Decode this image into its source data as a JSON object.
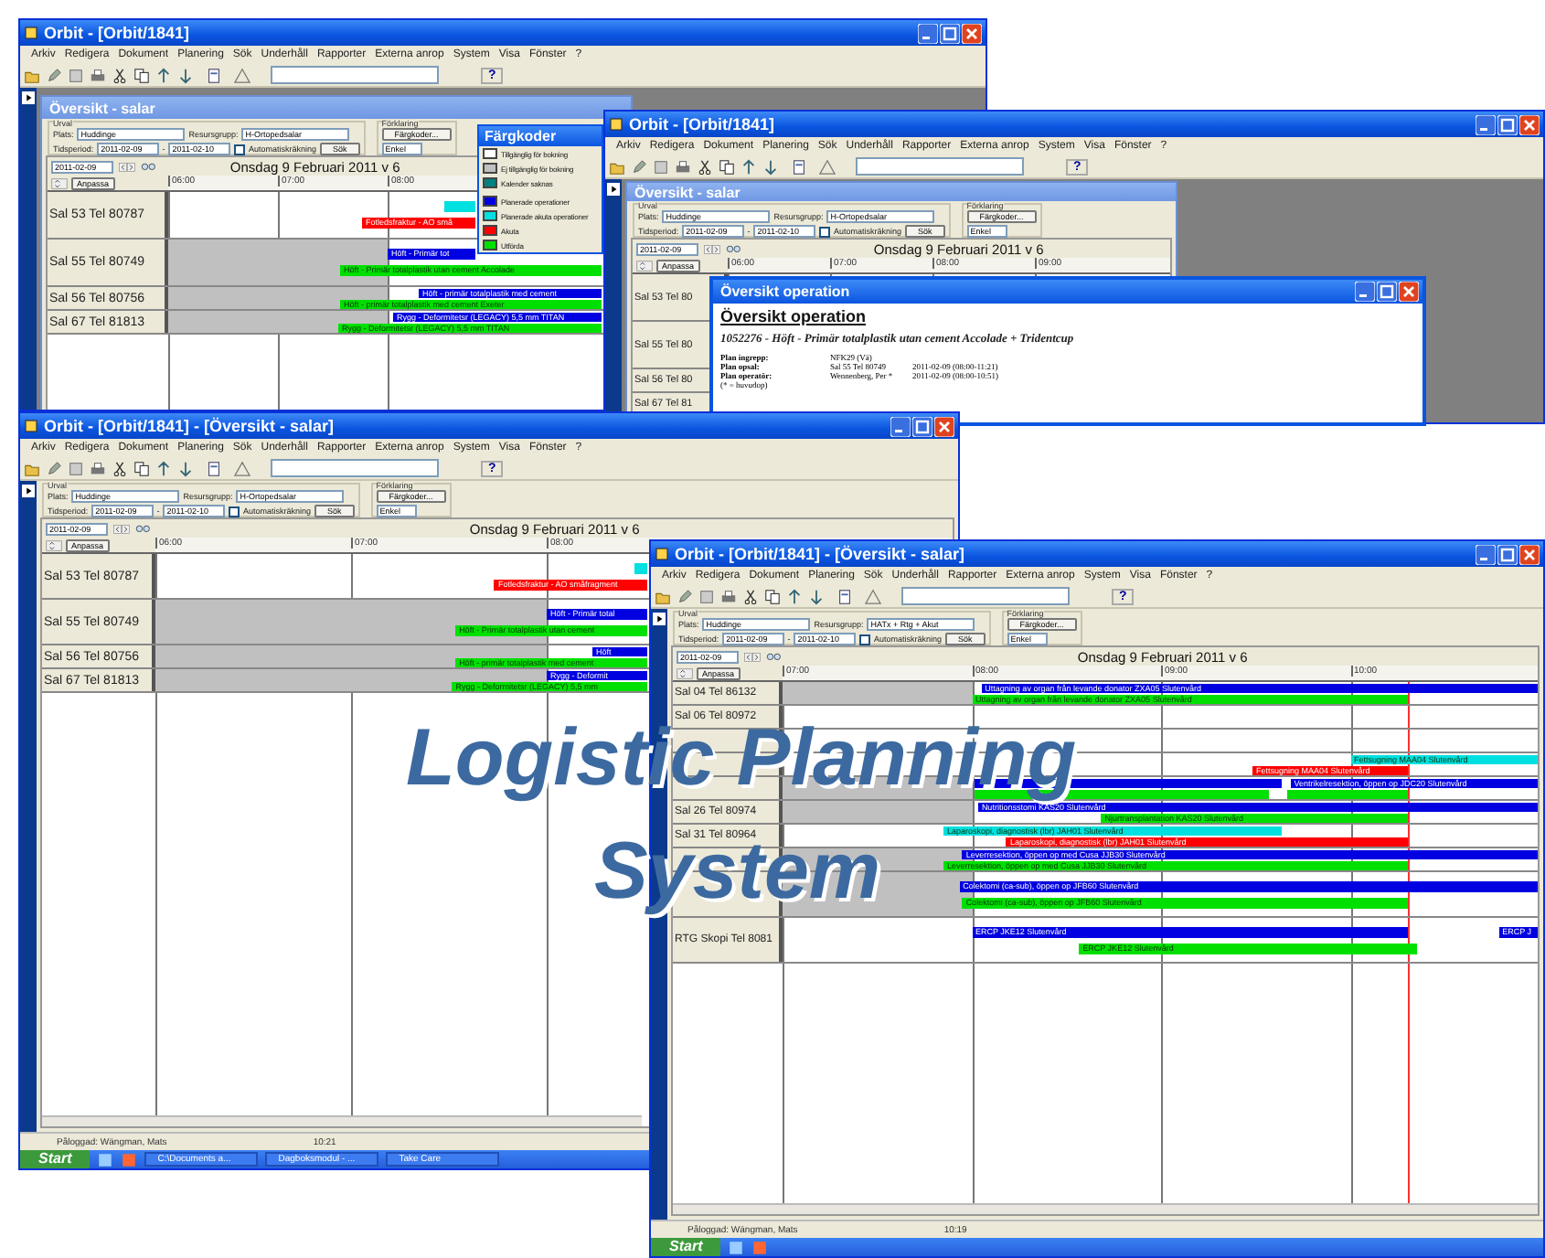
{
  "windows": [
    {
      "title": "Orbit - [Orbit/1841]",
      "menu": [
        "Arkiv",
        "Redigera",
        "Dokument",
        "Planering",
        "Sök",
        "Underhåll",
        "Rapporter",
        "Externa anrop",
        "System",
        "Visa",
        "Fönster",
        "?"
      ],
      "help": "?",
      "child": {
        "title": "Översikt - salar",
        "form": {
          "group": "Urval",
          "plats_label": "Plats:",
          "plats": "Huddinge",
          "resurs_label": "Resursgrupp:",
          "resurs": "H-Ortopedsalar",
          "period_label": "Tidsperiod:",
          "from": "2011-02-09",
          "dash": "-",
          "to": "2011-02-10",
          "auto_label": "Automatiskräkning",
          "auto_checked": false,
          "search": "Sök",
          "legend_group": "Förklaring",
          "legend_button": "Färgkoder...",
          "view": "Enkel"
        },
        "schedule": {
          "date": "2011-02-09",
          "heading": "Onsdag 9 Februari 2011 v 6",
          "adjust": "Anpassa",
          "times": [
            "06:00",
            "07:00",
            "08:00"
          ],
          "rows": [
            {
              "label": "Sal 53 Tel 80787",
              "unavailable": false,
              "lanes": [
                [
                  {
                    "color": "#00e0e0"
                  }
                ],
                [
                  {
                    "color": "#ff0000",
                    "text": "Fotledsfraktur - AO små"
                  }
                ]
              ]
            },
            {
              "label": "Sal 55 Tel 80749",
              "unavailable": true,
              "lanes": [
                [
                  {
                    "color": "#0000e0",
                    "text": "Höft - Primär tot"
                  }
                ],
                [
                  {
                    "color": "#00e000",
                    "text": "Höft - Primär totalplastik utan cement Accolade"
                  }
                ]
              ]
            },
            {
              "label": "Sal 56 Tel 80756",
              "unavailable": true,
              "lanes": [
                [
                  {
                    "color": "#0000e0",
                    "text": "Höft - primär totalplastik med cement"
                  }
                ],
                [
                  {
                    "color": "#00e000",
                    "text": "Höft - primär totalplastik med cement Exeter"
                  }
                ]
              ]
            },
            {
              "label": "Sal 67 Tel 81813",
              "unavailable": true,
              "lanes": [
                [
                  {
                    "color": "#0000e0",
                    "text": "Rygg - Deformitetsr (LEGACY) 5,5 mm TITAN"
                  }
                ],
                [
                  {
                    "color": "#00e000",
                    "text": "Rygg - Deformitetsr (LEGACY) 5,5 mm TITAN"
                  }
                ]
              ]
            }
          ]
        }
      }
    },
    {
      "title": "Orbit - [Orbit/1841]",
      "menu": [
        "Arkiv",
        "Redigera",
        "Dokument",
        "Planering",
        "Sök",
        "Underhåll",
        "Rapporter",
        "Externa anrop",
        "System",
        "Visa",
        "Fönster",
        "?"
      ],
      "help": "?",
      "child": {
        "title": "Översikt - salar",
        "form": {
          "group": "Urval",
          "plats_label": "Plats:",
          "plats": "Huddinge",
          "resurs_label": "Resursgrupp:",
          "resurs": "H-Ortopedsalar",
          "period_label": "Tidsperiod:",
          "from": "2011-02-09",
          "dash": "-",
          "to": "2011-02-10",
          "auto_label": "Automatiskräkning",
          "auto_checked": false,
          "search": "Sök",
          "legend_group": "Förklaring",
          "legend_button": "Färgkoder...",
          "view": "Enkel"
        },
        "schedule": {
          "date": "2011-02-09",
          "heading": "Onsdag 9 Februari 2011 v 6",
          "adjust": "Anpassa",
          "times": [
            "06:00",
            "07:00",
            "08:00",
            "09:00"
          ],
          "rows": [
            {
              "label": "Sal 53 Tel 80",
              "lanes": []
            },
            {
              "label": "Sal 55 Tel 80",
              "lanes": []
            },
            {
              "label": "Sal 56 Tel 80",
              "lanes": []
            },
            {
              "label": "Sal 67 Tel 81",
              "lanes": []
            }
          ]
        }
      }
    },
    {
      "title": "Orbit - [Orbit/1841] - [Översikt - salar]",
      "menu": [
        "Arkiv",
        "Redigera",
        "Dokument",
        "Planering",
        "Sök",
        "Underhåll",
        "Rapporter",
        "Externa anrop",
        "System",
        "Visa",
        "Fönster",
        "?"
      ],
      "help": "?",
      "form": {
        "group": "Urval",
        "plats_label": "Plats:",
        "plats": "Huddinge",
        "resurs_label": "Resursgrupp:",
        "resurs": "H-Ortopedsalar",
        "period_label": "Tidsperiod:",
        "from": "2011-02-09",
        "dash": "-",
        "to": "2011-02-10",
        "auto_label": "Automatiskräkning",
        "auto_checked": false,
        "search": "Sök",
        "legend_group": "Förklaring",
        "legend_button": "Färgkoder...",
        "view": "Enkel"
      },
      "schedule": {
        "date": "2011-02-09",
        "heading": "Onsdag 9 Februari 2011 v 6",
        "adjust": "Anpassa",
        "times": [
          "06:00",
          "07:00",
          "08:00"
        ],
        "rows": [
          {
            "label": "Sal 53 Tel 80787",
            "unavailable": false,
            "lanes": [
              [
                {
                  "color": "#00e0e0"
                }
              ],
              [
                {
                  "color": "#ff0000",
                  "text": "Fotledsfraktur - AO småfragment"
                }
              ]
            ]
          },
          {
            "label": "Sal 55 Tel 80749",
            "unavailable": true,
            "lanes": [
              [
                {
                  "color": "#0000e0",
                  "text": "Höft - Primär total"
                }
              ],
              [
                {
                  "color": "#00e000",
                  "text": "Höft - Primär totalplastik utan cement"
                }
              ]
            ]
          },
          {
            "label": "Sal 56 Tel 80756",
            "unavailable": true,
            "lanes": [
              [
                {
                  "color": "#0000e0",
                  "text": "Höft"
                }
              ],
              [
                {
                  "color": "#00e000",
                  "text": "Höft - primär totalplastik med cement"
                }
              ]
            ]
          },
          {
            "label": "Sal 67 Tel 81813",
            "unavailable": true,
            "lanes": [
              [
                {
                  "color": "#0000e0",
                  "text": "Rygg - Deformit"
                }
              ],
              [
                {
                  "color": "#00e000",
                  "text": "Rygg - Deformitetsr (LEGACY) 5,5 mm"
                }
              ]
            ]
          }
        ]
      },
      "status": {
        "user": "Påloggad: Wängman, Mats",
        "time": "10:21"
      },
      "taskbar": {
        "start": "Start",
        "tasks": [
          "C:\\Documents a...",
          "Dagboksmodul - ...",
          "Take Care"
        ]
      }
    },
    {
      "title": "Orbit - [Orbit/1841] - [Översikt - salar]",
      "menu": [
        "Arkiv",
        "Redigera",
        "Dokument",
        "Planering",
        "Sök",
        "Underhåll",
        "Rapporter",
        "Externa anrop",
        "System",
        "Visa",
        "Fönster",
        "?"
      ],
      "help": "?",
      "form": {
        "group": "Urval",
        "plats_label": "Plats:",
        "plats": "Huddinge",
        "resurs_label": "Resursgrupp:",
        "resurs": "HATx + Rtg + Akut",
        "period_label": "Tidsperiod:",
        "from": "2011-02-09",
        "dash": "-",
        "to": "2011-02-10",
        "auto_label": "Automatiskräkning",
        "auto_checked": false,
        "search": "Sök",
        "legend_group": "Förklaring",
        "legend_button": "Färgkoder...",
        "view": "Enkel"
      },
      "schedule": {
        "date": "2011-02-09",
        "heading": "Onsdag 9 Februari 2011 v 6",
        "adjust": "Anpassa",
        "times": [
          "07:00",
          "08:00",
          "09:00",
          "10:00"
        ],
        "now_line": true,
        "rows": [
          {
            "label": "Sal 04 Tel 86132",
            "unavailable": true,
            "lanes": [
              [
                {
                  "color": "#0000e0",
                  "text": "Uttagning av organ från levande donator ZXA05 Slutenvård"
                }
              ],
              [
                {
                  "color": "#00e000",
                  "text": "Uttagning av organ från levande donator ZXA05 Slutenvård"
                }
              ]
            ]
          },
          {
            "label": "Sal 06 Tel 80972",
            "unavailable": false,
            "lanes": []
          },
          {
            "unavailable": false,
            "lanes": []
          },
          {
            "unavailable": false,
            "lanes": [
              [
                {
                  "color": "#00e0e0",
                  "text": "Fettsugning MAA04 Slutenvård"
                }
              ],
              [
                {
                  "color": "#ff0000",
                  "text": "Fettsugning MAA04 Slutenvård"
                }
              ]
            ]
          },
          {
            "unavailable": true,
            "lanes": [
              [
                {
                  "color": "#0000e0"
                },
                {
                  "color": "#0000e0",
                  "text": "Ventrikelresektion, öppen op JDC20 Slutenvård"
                }
              ],
              [
                {
                  "color": "#00e000"
                },
                {
                  "color": "#00e000"
                }
              ]
            ]
          },
          {
            "label": "Sal 26 Tel 80974",
            "unavailable": true,
            "lanes": [
              [
                {
                  "color": "#0000e0",
                  "text": "Nutritionsstomi KAS20 Slutenvård"
                }
              ],
              [
                {
                  "color": "#00e000",
                  "text": "Njurtransplantation KAS20 Slutenvård"
                }
              ]
            ]
          },
          {
            "label": "Sal 31 Tel 80964",
            "unavailable": false,
            "lanes": [
              [
                {
                  "color": "#00e0e0",
                  "text": "Laparoskopi, diagnostisk (lbr) JAH01 Slutenvård"
                }
              ],
              [
                {
                  "color": "#ff0000",
                  "text": "Laparoskopi, diagnostisk (lbr) JAH01 Slutenvård"
                }
              ]
            ]
          },
          {
            "unavailable": true,
            "lanes": [
              [
                {
                  "color": "#0000e0",
                  "text": "Leverresektion, öppen op med Cusa JJB30 Slutenvård"
                }
              ],
              [
                {
                  "color": "#00e000",
                  "text": "Leverresektion, öppen op med Cusa JJB30 Slutenvård"
                }
              ]
            ]
          },
          {
            "unavailable": true,
            "lanes": [
              [
                {
                  "color": "#0000e0",
                  "text": "Colektomi (ca-sub), öppen op JFB60 Slutenvård"
                }
              ],
              [
                {
                  "color": "#00e000",
                  "text": "Colektomi (ca-sub), öppen op JFB60 Slutenvård"
                }
              ]
            ]
          },
          {
            "label": "RTG Skopi Tel 8081",
            "unavailable": false,
            "lanes": [
              [
                {
                  "color": "#0000e0",
                  "text": "ERCP JKE12 Slutenvård"
                },
                {
                  "color": "#0000e0",
                  "text": "ERCP J"
                }
              ],
              [
                {
                  "color": "#00e000",
                  "text": "ERCP JKE12 Slutenvård"
                }
              ]
            ]
          }
        ]
      },
      "status": {
        "user": "Påloggad: Wängman, Mats",
        "time": "10:19"
      },
      "taskbar": {
        "start": "Start"
      }
    }
  ],
  "color_legend": {
    "title": "Färgkoder",
    "items": [
      {
        "label": "Tillgänglig för bokning",
        "color": "#ffffff"
      },
      {
        "label": "Ej tillgänglig för bokning",
        "color": "#c0c0c0"
      },
      {
        "label": "Kalender saknas",
        "color": "#008080"
      },
      {
        "label": "Planerade operationer",
        "color": "#0000e0"
      },
      {
        "label": "Planerade akuta operationer",
        "color": "#00e0e0"
      },
      {
        "label": "Akuta",
        "color": "#ff0000"
      },
      {
        "label": "Utförda",
        "color": "#00e000"
      }
    ]
  },
  "operation_popup": {
    "title": "Översikt operation",
    "heading": "Översikt operation",
    "subtitle": "1052276 - Höft - Primär totalplastik utan cement Accolade + Tridentcup",
    "fields": [
      {
        "label": "Plan ingrepp:",
        "value": "NFK29 (Vä)"
      },
      {
        "label": "Plan opsal:",
        "value": "Sal 55 Tel 80749",
        "time": "2011-02-09 (08:00-11:21)"
      },
      {
        "label": "Plan operatör:",
        "value": "Wennenberg, Per *",
        "time": "2011-02-09 (08:00-10:51)"
      }
    ],
    "note": "(* = huvudop)"
  },
  "banner": [
    "Logistic Planning",
    "System"
  ]
}
